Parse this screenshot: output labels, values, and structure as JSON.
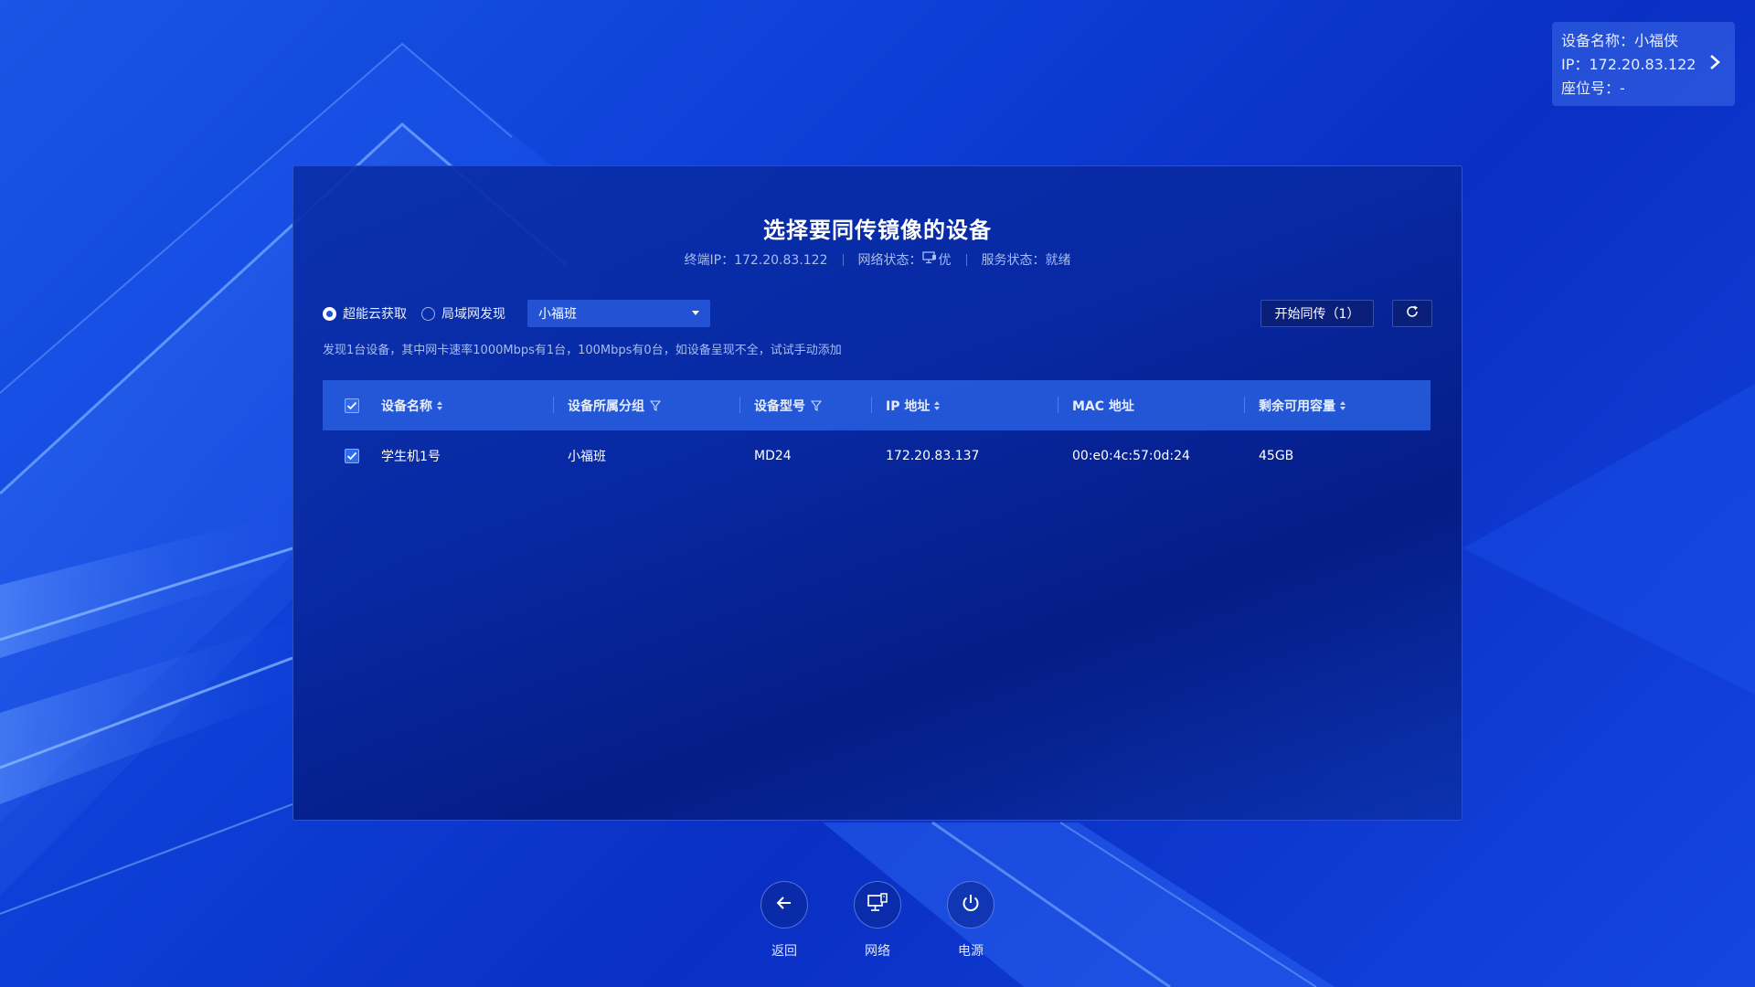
{
  "device_card": {
    "name_line": "设备名称：小福侠",
    "ip_line": "IP：172.20.83.122",
    "seat_line": "座位号：-",
    "arrow_icon": "chevron-right-icon"
  },
  "panel": {
    "title": "选择要同传镜像的设备",
    "status": {
      "terminal_ip": "终端IP：172.20.83.122",
      "network_label": "网络状态：",
      "network_value": "优",
      "service_status": "服务状态：就绪"
    },
    "source_options": [
      {
        "label": "超能云获取",
        "checked": true
      },
      {
        "label": "局域网发现",
        "checked": false
      }
    ],
    "group_select": {
      "value": "小福班"
    },
    "start_button": "开始同传（1）",
    "refresh_icon": "refresh-icon",
    "hint": "发现1台设备，其中网卡速率1000Mbps有1台，100Mbps有0台，如设备呈现不全，试试手动添加",
    "table": {
      "columns": [
        {
          "label": "设备名称",
          "control": "sort"
        },
        {
          "label": "设备所属分组",
          "control": "filter"
        },
        {
          "label": "设备型号",
          "control": "filter"
        },
        {
          "label": "IP 地址",
          "control": "sort"
        },
        {
          "label": "MAC 地址",
          "control": "none"
        },
        {
          "label": "剩余可用容量",
          "control": "sort"
        }
      ],
      "rows": [
        {
          "checked": true,
          "name": "学生机1号",
          "group": "小福班",
          "model": "MD24",
          "ip": "172.20.83.137",
          "mac": "00:e0:4c:57:0d:24",
          "capacity": "45GB"
        }
      ]
    }
  },
  "dock": {
    "back": {
      "label": "返回",
      "icon": "arrow-left-icon"
    },
    "network": {
      "label": "网络",
      "icon": "network-icon"
    },
    "power": {
      "label": "电源",
      "icon": "power-icon"
    }
  },
  "colors": {
    "background": "#0d3fd6",
    "panel": "#0a2ea8",
    "table_header": "#285fe1",
    "button_dark": "#0a1f7a",
    "checkbox": "#2f6bf0"
  }
}
